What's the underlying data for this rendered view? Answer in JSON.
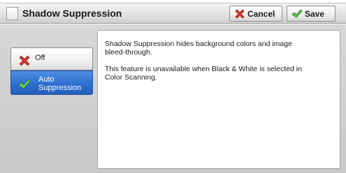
{
  "header": {
    "title": "Shadow Suppression",
    "cancel_label": "Cancel",
    "save_label": "Save"
  },
  "options": {
    "off_label": "Off",
    "auto_label": "Auto Suppression",
    "selected": "Auto Suppression"
  },
  "description": {
    "line1": "Shadow Suppression hides background colors and image bleed-through.",
    "line2": "This feature is unavailable when Black & White is selected in Color Scanning."
  },
  "icons": {
    "cancel": "red-x-icon",
    "save": "green-check-icon",
    "off": "red-x-icon",
    "auto": "green-check-icon"
  },
  "colors": {
    "selected_option": "#2f6fd0",
    "cancel_icon": "#d83a2e",
    "save_icon": "#5cc04a"
  }
}
